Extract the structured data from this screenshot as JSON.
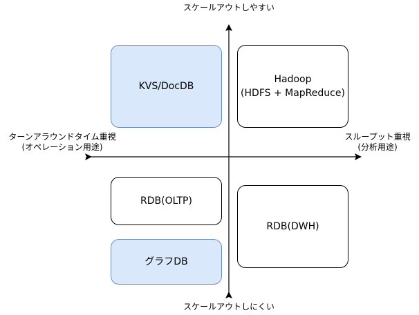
{
  "axes": {
    "top": "スケールアウトしやすい",
    "bottom": "スケールアウトしにくい",
    "left_line1": "ターンアラウンドタイム重視",
    "left_line2": "(オペレーション用途)",
    "right_line1": "スループット重視",
    "right_line2": "(分析用途)"
  },
  "boxes": {
    "kvs": {
      "label": "KVS/DocDB"
    },
    "hadoop": {
      "line1": "Hadoop",
      "line2": "(HDFS + MapReduce)"
    },
    "rdb_oltp": {
      "label": "RDB(OLTP)"
    },
    "rdb_dwh": {
      "label": "RDB(DWH)"
    },
    "graph_db": {
      "label": "グラフDB"
    }
  },
  "colors": {
    "highlight_fill": "#dae8fc",
    "highlight_stroke": "#6c8ebf",
    "line": "#000000"
  }
}
